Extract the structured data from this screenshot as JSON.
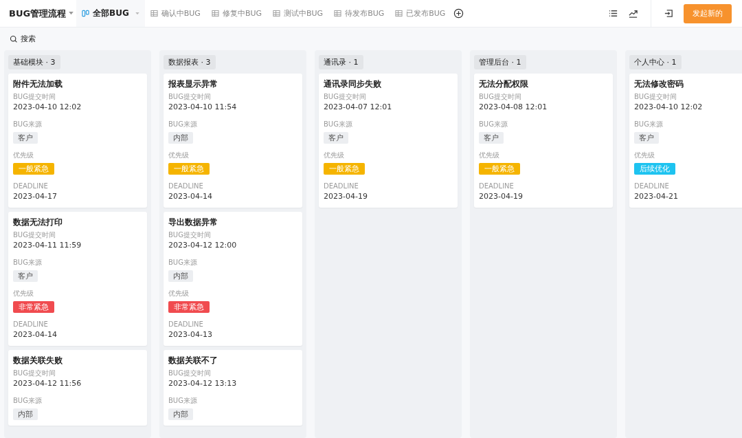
{
  "header": {
    "title": "BUG管理流程",
    "action_button": "发起新的"
  },
  "tabs": [
    {
      "label": "全部BUG",
      "selected": true
    },
    {
      "label": "确认中BUG",
      "selected": false
    },
    {
      "label": "修复中BUG",
      "selected": false
    },
    {
      "label": "测试中BUG",
      "selected": false
    },
    {
      "label": "待发布BUG",
      "selected": false
    },
    {
      "label": "已发布BUG",
      "selected": false
    }
  ],
  "search": {
    "label": "搜索"
  },
  "columns": [
    {
      "title": "基础模块 · 3",
      "cards": [
        {
          "title": "附件无法加载",
          "time_label": "BUG提交时间",
          "time": "2023-04-10 12:02",
          "source_label": "BUG来源",
          "source": "客户",
          "priority_label": "优先级",
          "priority": "一般紧急",
          "color": "#f5b400",
          "deadline_label": "DEADLINE",
          "deadline": "2023-04-17"
        },
        {
          "title": "数据无法打印",
          "time_label": "BUG提交时间",
          "time": "2023-04-11 11:59",
          "source_label": "BUG来源",
          "source": "客户",
          "priority_label": "优先级",
          "priority": "非常紧急",
          "color": "#f04b4f",
          "deadline_label": "DEADLINE",
          "deadline": "2023-04-14"
        },
        {
          "title": "数据关联失败",
          "time_label": "BUG提交时间",
          "time": "2023-04-12 11:56",
          "source_label": "BUG来源",
          "source": "内部"
        }
      ]
    },
    {
      "title": "数据报表 · 3",
      "cards": [
        {
          "title": "报表显示异常",
          "time_label": "BUG提交时间",
          "time": "2023-04-10 11:54",
          "source_label": "BUG来源",
          "source": "内部",
          "priority_label": "优先级",
          "priority": "一般紧急",
          "color": "#f5b400",
          "deadline_label": "DEADLINE",
          "deadline": "2023-04-14"
        },
        {
          "title": "导出数据异常",
          "time_label": "BUG提交时间",
          "time": "2023-04-12 12:00",
          "source_label": "BUG来源",
          "source": "内部",
          "priority_label": "优先级",
          "priority": "非常紧急",
          "color": "#f04b4f",
          "deadline_label": "DEADLINE",
          "deadline": "2023-04-13"
        },
        {
          "title": "数据关联不了",
          "time_label": "BUG提交时间",
          "time": "2023-04-12 13:13",
          "source_label": "BUG来源",
          "source": "内部"
        }
      ]
    },
    {
      "title": "通讯录 · 1",
      "cards": [
        {
          "title": "通讯录同步失败",
          "time_label": "BUG提交时间",
          "time": "2023-04-07 12:01",
          "source_label": "BUG来源",
          "source": "客户",
          "priority_label": "优先级",
          "priority": "一般紧急",
          "color": "#f5b400",
          "deadline_label": "DEADLINE",
          "deadline": "2023-04-19"
        }
      ]
    },
    {
      "title": "管理后台 · 1",
      "cards": [
        {
          "title": "无法分配权限",
          "time_label": "BUG提交时间",
          "time": "2023-04-08 12:01",
          "source_label": "BUG来源",
          "source": "客户",
          "priority_label": "优先级",
          "priority": "一般紧急",
          "color": "#f5b400",
          "deadline_label": "DEADLINE",
          "deadline": "2023-04-19"
        }
      ]
    },
    {
      "title": "个人中心 · 1",
      "cards": [
        {
          "title": "无法修改密码",
          "time_label": "BUG提交时间",
          "time": "2023-04-10 12:02",
          "source_label": "BUG来源",
          "source": "客户",
          "priority_label": "优先级",
          "priority": "后续优化",
          "color": "#1ec3f0",
          "deadline_label": "DEADLINE",
          "deadline": "2023-04-21"
        }
      ]
    }
  ]
}
